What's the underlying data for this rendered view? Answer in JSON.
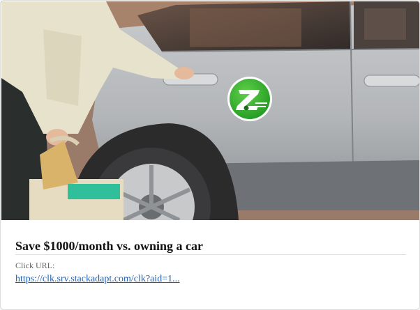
{
  "ad": {
    "headline": "Save $1000/month vs. owning a car",
    "click_url_label": "Click URL:",
    "click_url": "https://clk.srv.stackadapt.com/clk?aid=1..."
  },
  "colors": {
    "link": "#1a5fb4",
    "brand_green": "#35b52a"
  },
  "icons": [
    "zipcar-logo-icon"
  ]
}
